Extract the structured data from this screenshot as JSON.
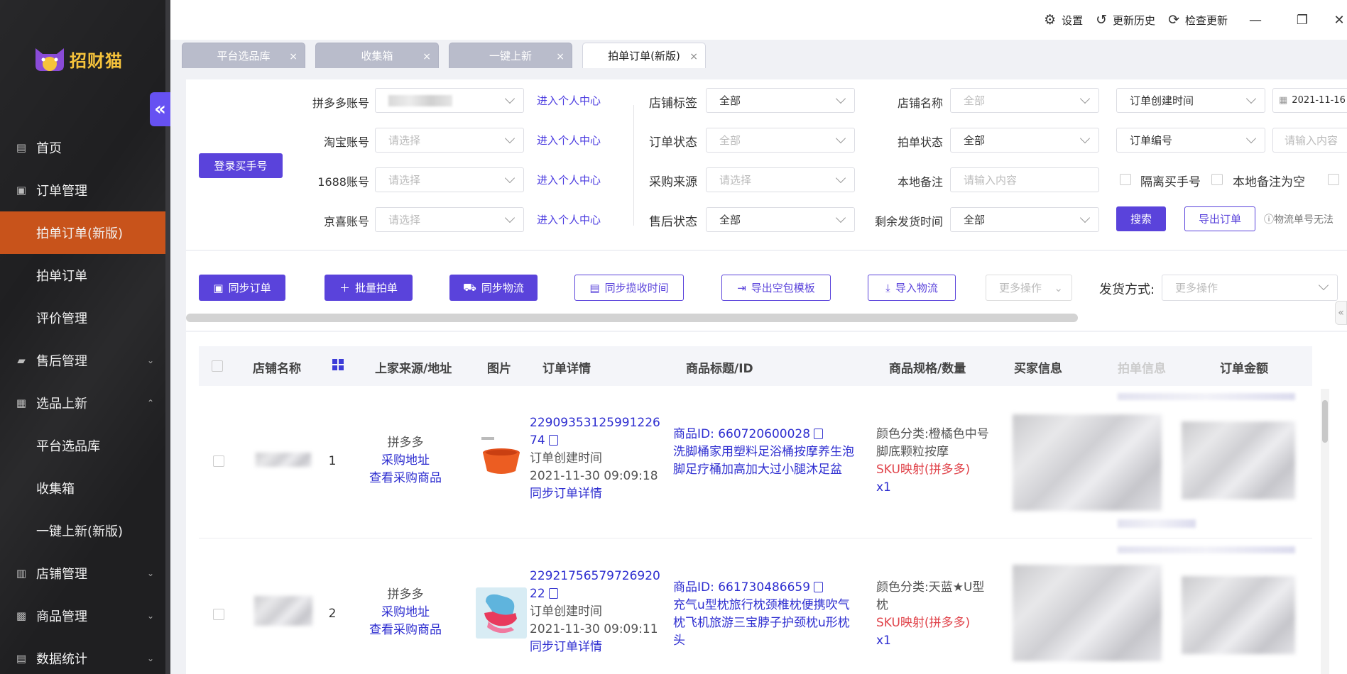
{
  "brand": {
    "name": "招财猫"
  },
  "sidebar": {
    "items": [
      {
        "label": "首页",
        "icon": "chart-icon"
      },
      {
        "label": "订单管理",
        "icon": "clipboard-icon"
      },
      {
        "label": "拍单订单(新版)"
      },
      {
        "label": "拍单订单"
      },
      {
        "label": "评价管理"
      },
      {
        "label": "售后管理",
        "icon": "chat-icon"
      },
      {
        "label": "选品上新",
        "icon": "image-icon"
      },
      {
        "label": "平台选品库"
      },
      {
        "label": "收集箱"
      },
      {
        "label": "一键上新(新版)"
      },
      {
        "label": "店铺管理",
        "icon": "store-icon"
      },
      {
        "label": "商品管理",
        "icon": "goods-icon"
      },
      {
        "label": "数据统计",
        "icon": "stats-icon"
      }
    ]
  },
  "topbar": {
    "settings": "设置",
    "history": "更新历史",
    "check_update": "检查更新"
  },
  "tabs": [
    {
      "label": "平台选品库"
    },
    {
      "label": "收集箱"
    },
    {
      "label": "一键上新"
    },
    {
      "label": "拍单订单(新版)"
    }
  ],
  "filters": {
    "login_button": "登录买手号",
    "pdd_account": "拼多多账号",
    "taobao_account": "淘宝账号",
    "account_1688": "1688账号",
    "jx_account": "京喜账号",
    "select_placeholder": "请选择",
    "enter_center": "进入个人中心",
    "shop_tag": "店铺标签",
    "order_status": "订单状态",
    "purchase_source": "采购来源",
    "after_sale_status": "售后状态",
    "shop_name": "店铺名称",
    "pai_status": "拍单状态",
    "local_note": "本地备注",
    "remain_ship_time": "剩余发货时间",
    "all": "全部",
    "input_placeholder": "请输入内容",
    "order_create_time": "订单创建时间",
    "order_no": "订单编号",
    "date_start": "2021-11-16",
    "input_placeholder_short": "请输入内容",
    "isolate_buyer": "隔离买手号",
    "local_note_empty": "本地备注为空",
    "search": "搜索",
    "export_orders": "导出订单",
    "hint": "ⓘ物流单号无法"
  },
  "actions": {
    "sync_orders": "同步订单",
    "batch_pai": "批量拍单",
    "sync_logistics": "同步物流",
    "sync_collect_time": "同步揽收时间",
    "export_empty_tpl": "导出空包模板",
    "import_logistics": "导入物流",
    "more_ops": "更多操作",
    "ship_method": "发货方式:",
    "ship_placeholder": "更多操作"
  },
  "table": {
    "headers": {
      "shop_name": "店铺名称",
      "source": "上家来源/地址",
      "image": "图片",
      "order_detail": "订单详情",
      "goods_title": "商品标题/ID",
      "spec_qty": "商品规格/数量",
      "buyer_info": "买家信息",
      "pai_info": "拍单信息",
      "order_amount": "订单金额"
    },
    "rows": [
      {
        "index": "1",
        "source_platform": "拼多多",
        "purchase_addr": "采购地址",
        "view_goods": "查看采购商品",
        "order_no_line1": "22909353125991226",
        "order_no_line2": "74",
        "create_time_label": "订单创建时间",
        "create_time": "2021-11-30 09:09:18",
        "sync_detail": "同步订单详情",
        "goods_id": "商品ID:  660720600028",
        "goods_title": "洗脚桶家用塑料足浴桶按摩养生泡脚足疗桶加高加大过小腿沐足盆",
        "spec": "颜色分类:橙橘色中号脚底颗粒按摩",
        "sku_map": "SKU映射(拼多多)",
        "qty": "x1"
      },
      {
        "index": "2",
        "source_platform": "拼多多",
        "purchase_addr": "采购地址",
        "view_goods": "查看采购商品",
        "order_no_line1": "22921756579726920",
        "order_no_line2": "22",
        "create_time_label": "订单创建时间",
        "create_time": "2021-11-30 09:09:11",
        "sync_detail": "同步订单详情",
        "goods_id": "商品ID:  661730486659",
        "goods_title": "充气u型枕旅行枕颈椎枕便携吹气枕飞机旅游三宝脖子护颈枕u形枕头",
        "spec": "颜色分类:天蓝★U型枕",
        "sku_map": "SKU映射(拼多多)",
        "qty": "x1"
      }
    ]
  },
  "colors": {
    "accent": "#5a43db",
    "active_menu": "#c8531b",
    "sidebar": "#1f1f21",
    "link": "#2e2ed0",
    "red": "#e0434a"
  }
}
